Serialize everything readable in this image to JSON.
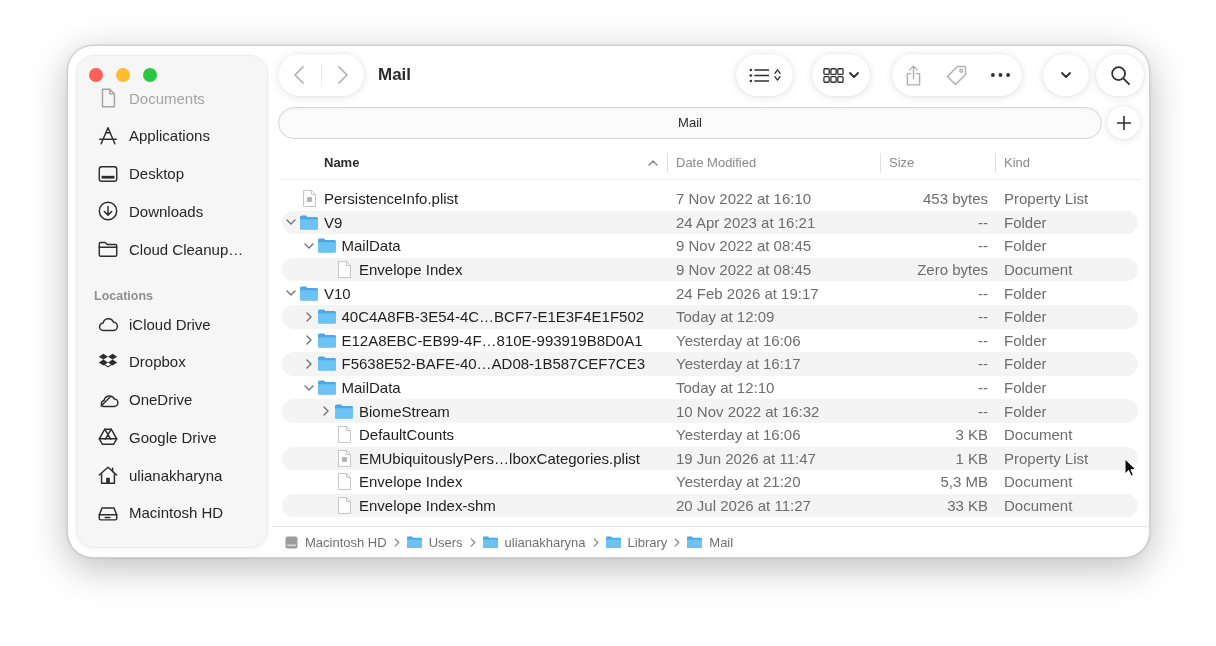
{
  "toolbar": {
    "title": "Mail",
    "navigation": [
      {
        "kind": "back",
        "disabled": true
      },
      {
        "kind": "forward",
        "disabled": true
      }
    ],
    "actions": [
      {
        "kind": "share",
        "disabled": true
      },
      {
        "kind": "tag",
        "disabled": true
      },
      {
        "kind": "more",
        "disabled": false
      }
    ]
  },
  "sidebar": {
    "sections": [
      {
        "items": [
          {
            "label": "Documents",
            "kind": "documents",
            "dimmed": true
          },
          {
            "label": "Applications",
            "kind": "applications",
            "dimmed": false
          },
          {
            "label": "Desktop",
            "kind": "desktop",
            "dimmed": false
          },
          {
            "label": "Downloads",
            "kind": "downloads",
            "dimmed": false
          },
          {
            "label": "Cloud Cleanup…",
            "kind": "folder",
            "dimmed": false
          }
        ]
      },
      {
        "title": "Locations",
        "items": [
          {
            "label": "iCloud Drive",
            "kind": "icloud",
            "dimmed": false
          },
          {
            "label": "Dropbox",
            "kind": "dropbox",
            "dimmed": false
          },
          {
            "label": "OneDrive",
            "kind": "onedrive",
            "dimmed": false
          },
          {
            "label": "Google Drive",
            "kind": "googledrive",
            "dimmed": false
          },
          {
            "label": "ulianakharyna",
            "kind": "home",
            "dimmed": false
          },
          {
            "label": "Macintosh HD",
            "kind": "disk",
            "dimmed": false
          }
        ]
      }
    ]
  },
  "tabs": [
    {
      "label": "Mail",
      "selected": true
    }
  ],
  "table": {
    "columns": [
      {
        "label": "Name",
        "sorted": true,
        "ascending": true
      },
      {
        "label": "Date Modified",
        "sorted": false
      },
      {
        "label": "Size",
        "sorted": false
      },
      {
        "label": "Kind",
        "sorted": false
      }
    ],
    "rows": [
      {
        "name": "PersistenceInfo.plist",
        "kind": "plist",
        "date_modified": "7 Nov 2022 at 16:10",
        "size": "453 bytes",
        "file_kind": "Property List",
        "selected": false
      },
      {
        "name": "V9",
        "kind": "folder",
        "expanded": true,
        "date_modified": "24 Apr 2023 at 16:21",
        "size": "--",
        "file_kind": "Folder",
        "selected": false,
        "children": [
          {
            "name": "MailData",
            "kind": "folder",
            "expanded": true,
            "date_modified": "9 Nov 2022 at 08:45",
            "size": "--",
            "file_kind": "Folder",
            "selected": false,
            "children": [
              {
                "name": "Envelope Index",
                "kind": "document",
                "date_modified": "9 Nov 2022 at 08:45",
                "size": "Zero bytes",
                "file_kind": "Document",
                "selected": false
              }
            ]
          }
        ]
      },
      {
        "name": "V10",
        "kind": "folder",
        "expanded": true,
        "date_modified": "24 Feb 2026 at 19:17",
        "size": "--",
        "file_kind": "Folder",
        "selected": false,
        "children": [
          {
            "name": "40C4A8FB-3E54-4C…BCF7-E1E3F4E1F502",
            "kind": "folder",
            "expanded": false,
            "date_modified": "Today at 12:09",
            "size": "--",
            "file_kind": "Folder",
            "selected": false
          },
          {
            "name": "E12A8EBC-EB99-4F…810E-993919B8D0A1",
            "kind": "folder",
            "expanded": false,
            "date_modified": "Yesterday at 16:06",
            "size": "--",
            "file_kind": "Folder",
            "selected": false
          },
          {
            "name": "F5638E52-BAFE-40…AD08-1B587CEF7CE3",
            "kind": "folder",
            "expanded": false,
            "date_modified": "Yesterday at 16:17",
            "size": "--",
            "file_kind": "Folder",
            "selected": false
          },
          {
            "name": "MailData",
            "kind": "folder",
            "expanded": true,
            "date_modified": "Today at 12:10",
            "size": "--",
            "file_kind": "Folder",
            "selected": false,
            "children": [
              {
                "name": "BiomeStream",
                "kind": "folder",
                "expanded": false,
                "date_modified": "10 Nov 2022 at 16:32",
                "size": "--",
                "file_kind": "Folder",
                "selected": false
              },
              {
                "name": "DefaultCounts",
                "kind": "document",
                "date_modified": "Yesterday at 16:06",
                "size": "3 KB",
                "file_kind": "Document",
                "selected": false
              },
              {
                "name": "EMUbiquitouslyPers…lboxCategories.plist",
                "kind": "plist",
                "date_modified": "19 Jun 2026 at 11:47",
                "size": "1 KB",
                "file_kind": "Property List",
                "selected": false
              },
              {
                "name": "Envelope Index",
                "kind": "document",
                "date_modified": "Yesterday at 21:20",
                "size": "5,3 MB",
                "file_kind": "Document",
                "selected": false
              },
              {
                "name": "Envelope Index-shm",
                "kind": "document",
                "date_modified": "20 Jul 2026 at 11:27",
                "size": "33 KB",
                "file_kind": "Document",
                "selected": false
              }
            ]
          }
        ]
      }
    ]
  },
  "path_bar": [
    {
      "label": "Macintosh HD",
      "kind": "disk"
    },
    {
      "label": "Users",
      "kind": "folder"
    },
    {
      "label": "ulianakharyna",
      "kind": "folder"
    },
    {
      "label": "Library",
      "kind": "folder"
    },
    {
      "label": "Mail",
      "kind": "folder"
    }
  ]
}
